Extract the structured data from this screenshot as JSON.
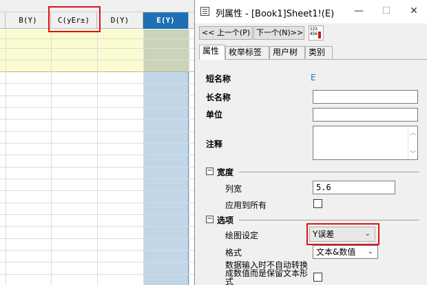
{
  "sheet": {
    "columns": [
      {
        "label": "B(Y)"
      },
      {
        "label": "C(yEr±)"
      },
      {
        "label": "D(Y)"
      },
      {
        "label": "E(Y)"
      }
    ]
  },
  "dialog": {
    "title": "列属性 - [Book1]Sheet1!(E)",
    "window_buttons": {
      "minimize": "—",
      "maximize": "☐",
      "close": "✕"
    },
    "toolbar": {
      "prev_label": "<< 上一个(P)",
      "next_label": "下一个(N)>>",
      "icon_text": "123\n456"
    },
    "tabs": [
      {
        "label": "属性"
      },
      {
        "label": "枚举标签"
      },
      {
        "label": "用户树"
      },
      {
        "label": "类别"
      }
    ],
    "properties": {
      "short_name_label": "短名称",
      "short_name_value": "E",
      "long_name_label": "长名称",
      "long_name_value": "",
      "units_label": "单位",
      "units_value": "",
      "comments_label": "注释",
      "comments_value": ""
    },
    "width_section": {
      "toggle": "−",
      "title": "宽度",
      "col_width_label": "列宽",
      "col_width_value": "5.6",
      "apply_all_label": "应用到所有"
    },
    "options_section": {
      "toggle": "−",
      "title": "选项",
      "plot_designation_label": "绘图设定",
      "plot_designation_value": "Y误差",
      "format_label": "格式",
      "format_value": "文本&数值",
      "no_convert_label": "数据输入时不自动转换成数值而是保留文本形式"
    }
  }
}
